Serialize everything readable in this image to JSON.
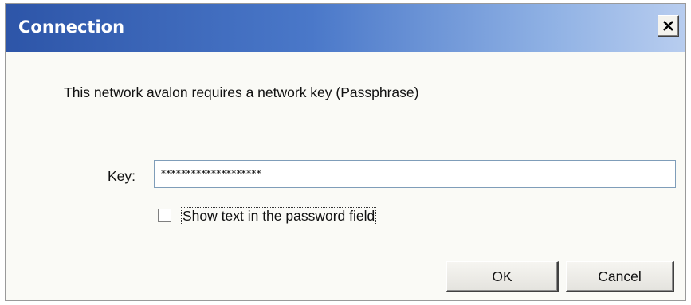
{
  "dialog": {
    "title": "Connection",
    "message": "This network avalon requires a network key (Passphrase)",
    "key_label": "Key:",
    "key_value": "********************",
    "show_text_label": "Show text in the password field",
    "show_text_checked": false,
    "ok_label": "OK",
    "cancel_label": "Cancel"
  },
  "icons": {
    "close": "close-icon"
  },
  "colors": {
    "titlebar_start": "#2d55a8",
    "titlebar_end": "#b8cdef",
    "dialog_background": "#fafaf6"
  }
}
